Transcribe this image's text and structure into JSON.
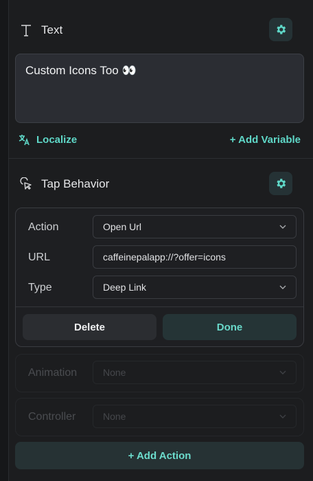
{
  "text_section": {
    "title": "Text",
    "content": "Custom Icons Too 👀",
    "localize_label": "Localize",
    "add_variable_label": "+ Add Variable"
  },
  "tap_section": {
    "title": "Tap Behavior"
  },
  "action_card": {
    "action_label": "Action",
    "action_value": "Open Url",
    "url_label": "URL",
    "url_value": "caffeinepalapp://?offer=icons",
    "type_label": "Type",
    "type_value": "Deep Link",
    "delete_label": "Delete",
    "done_label": "Done"
  },
  "animation": {
    "label": "Animation",
    "value": "None"
  },
  "controller": {
    "label": "Controller",
    "value": "None"
  },
  "add_action_label": "+ Add Action",
  "colors": {
    "accent": "#5fd8c8",
    "background": "#1c1d1f"
  }
}
